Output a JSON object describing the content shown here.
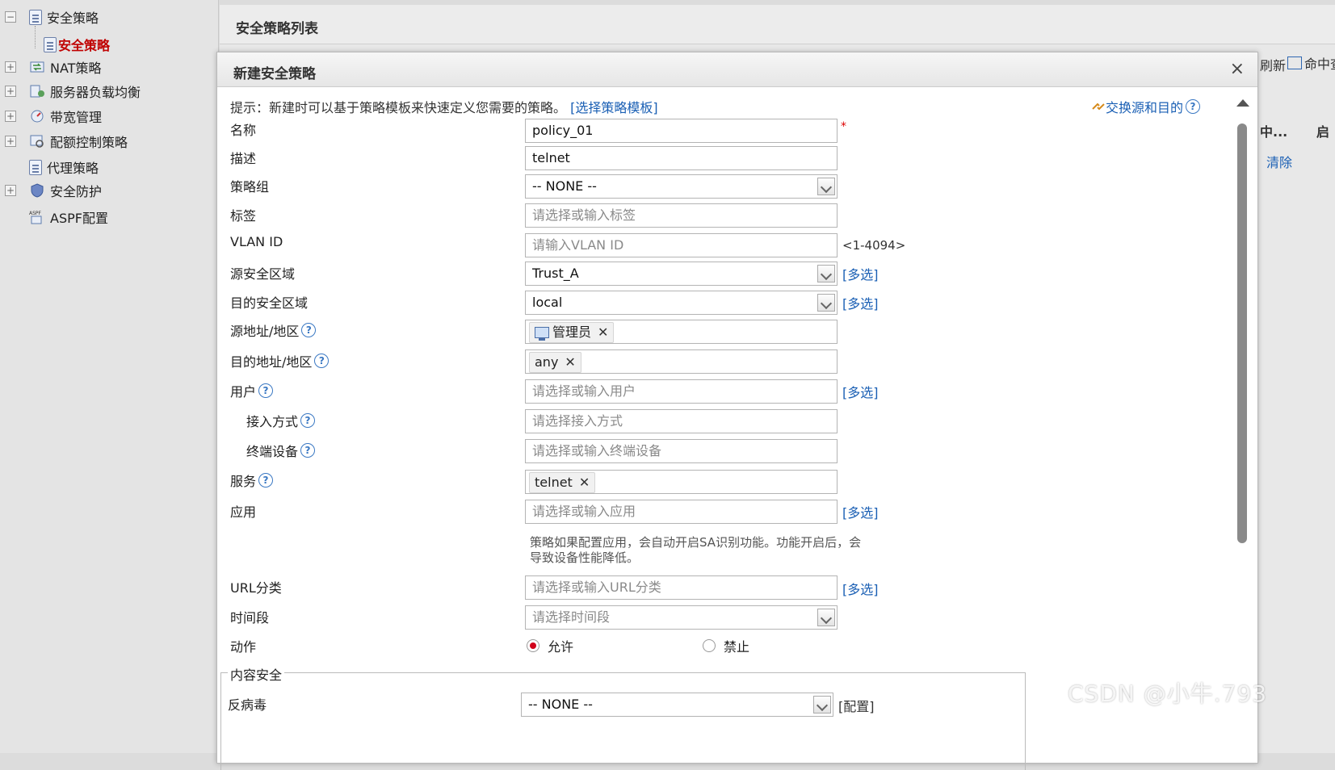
{
  "sidebar": {
    "items": [
      {
        "label": "安全策略",
        "toggle": "−",
        "icon": "policy-doc-icon"
      },
      {
        "label": "安全策略",
        "selected": true,
        "icon": "policy-doc-icon"
      },
      {
        "label": "NAT策略",
        "toggle": "+",
        "icon": "nat-icon"
      },
      {
        "label": "服务器负载均衡",
        "toggle": "+",
        "icon": "server-balance-icon"
      },
      {
        "label": "带宽管理",
        "toggle": "+",
        "icon": "bandwidth-icon"
      },
      {
        "label": "配额控制策略",
        "toggle": "+",
        "icon": "quota-icon"
      },
      {
        "label": "代理策略",
        "icon": "proxy-icon"
      },
      {
        "label": "安全防护",
        "toggle": "+",
        "icon": "shield-icon"
      },
      {
        "label": "ASPF配置",
        "icon": "aspf-icon",
        "icon_text": "ASPF"
      }
    ]
  },
  "list": {
    "title": "安全策略列表",
    "refresh_fragment": "刷新",
    "hit_fragment": "命中查",
    "col_fragment_1": "中...",
    "col_fragment_2": "启",
    "clear_label": "清除"
  },
  "dialog": {
    "title": "新建安全策略",
    "close": "×",
    "tip_text": "提示：新建时可以基于策略模板来快速定义您需要的策略。",
    "tip_link": "[选择策略模板]",
    "swap_link": "交换源和目的",
    "multi_select": "[多选]",
    "fields": {
      "name": {
        "label": "名称",
        "value": "policy_01"
      },
      "description": {
        "label": "描述",
        "value": "telnet"
      },
      "policy_group": {
        "label": "策略组",
        "value": "-- NONE --"
      },
      "tag": {
        "label": "标签",
        "placeholder": "请选择或输入标签"
      },
      "vlan": {
        "label": "VLAN ID",
        "placeholder": "请输入VLAN ID",
        "range": "<1-4094>"
      },
      "src_zone": {
        "label": "源安全区域",
        "value": "Trust_A"
      },
      "dst_zone": {
        "label": "目的安全区域",
        "value": "local"
      },
      "src_addr": {
        "label": "源地址/地区",
        "chip": "管理员"
      },
      "dst_addr": {
        "label": "目的地址/地区",
        "chip": "any"
      },
      "user": {
        "label": "用户",
        "placeholder": "请选择或输入用户"
      },
      "access": {
        "label": "接入方式",
        "placeholder": "请选择接入方式"
      },
      "terminal": {
        "label": "终端设备",
        "placeholder": "请选择或输入终端设备"
      },
      "service": {
        "label": "服务",
        "chip": "telnet"
      },
      "application": {
        "label": "应用",
        "placeholder": "请选择或输入应用",
        "note": "策略如果配置应用，会自动开启SA识别功能。功能开启后，会导致设备性能降低。"
      },
      "url": {
        "label": "URL分类",
        "placeholder": "请选择或输入URL分类"
      },
      "time": {
        "label": "时间段",
        "placeholder": "请选择时间段"
      },
      "action": {
        "label": "动作",
        "options": [
          "允许",
          "禁止"
        ],
        "selected": "允许"
      }
    },
    "content_security": {
      "title": "内容安全",
      "antivirus": {
        "label": "反病毒",
        "value": "-- NONE --",
        "config_link": "[配置]"
      }
    }
  },
  "watermark": "CSDN @小牛.793"
}
